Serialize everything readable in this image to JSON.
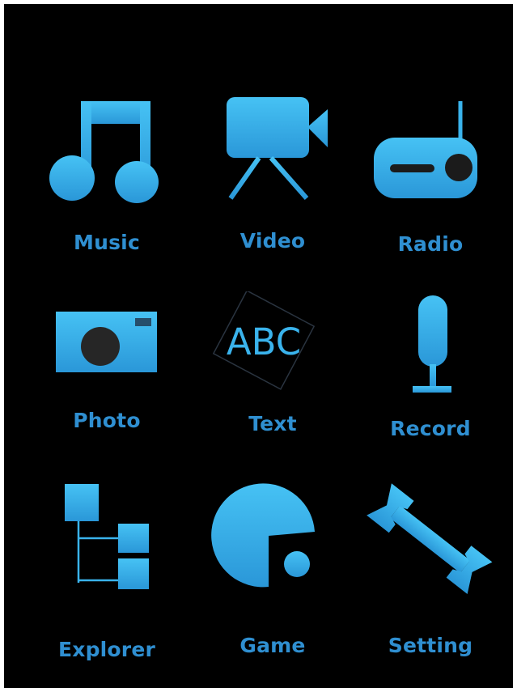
{
  "accent_color": "#3ab3ec",
  "background_color": "#000000",
  "menu": {
    "items": [
      {
        "label": "Music",
        "icon": "music-note-icon"
      },
      {
        "label": "Video",
        "icon": "video-camera-icon"
      },
      {
        "label": "Radio",
        "icon": "radio-icon"
      },
      {
        "label": "Photo",
        "icon": "camera-icon"
      },
      {
        "label": "Text",
        "icon": "text-abc-icon",
        "icon_text": "ABC"
      },
      {
        "label": "Record",
        "icon": "microphone-icon"
      },
      {
        "label": "Explorer",
        "icon": "folder-tree-icon"
      },
      {
        "label": "Game",
        "icon": "pacman-icon"
      },
      {
        "label": "Setting",
        "icon": "wrench-icon"
      }
    ]
  }
}
